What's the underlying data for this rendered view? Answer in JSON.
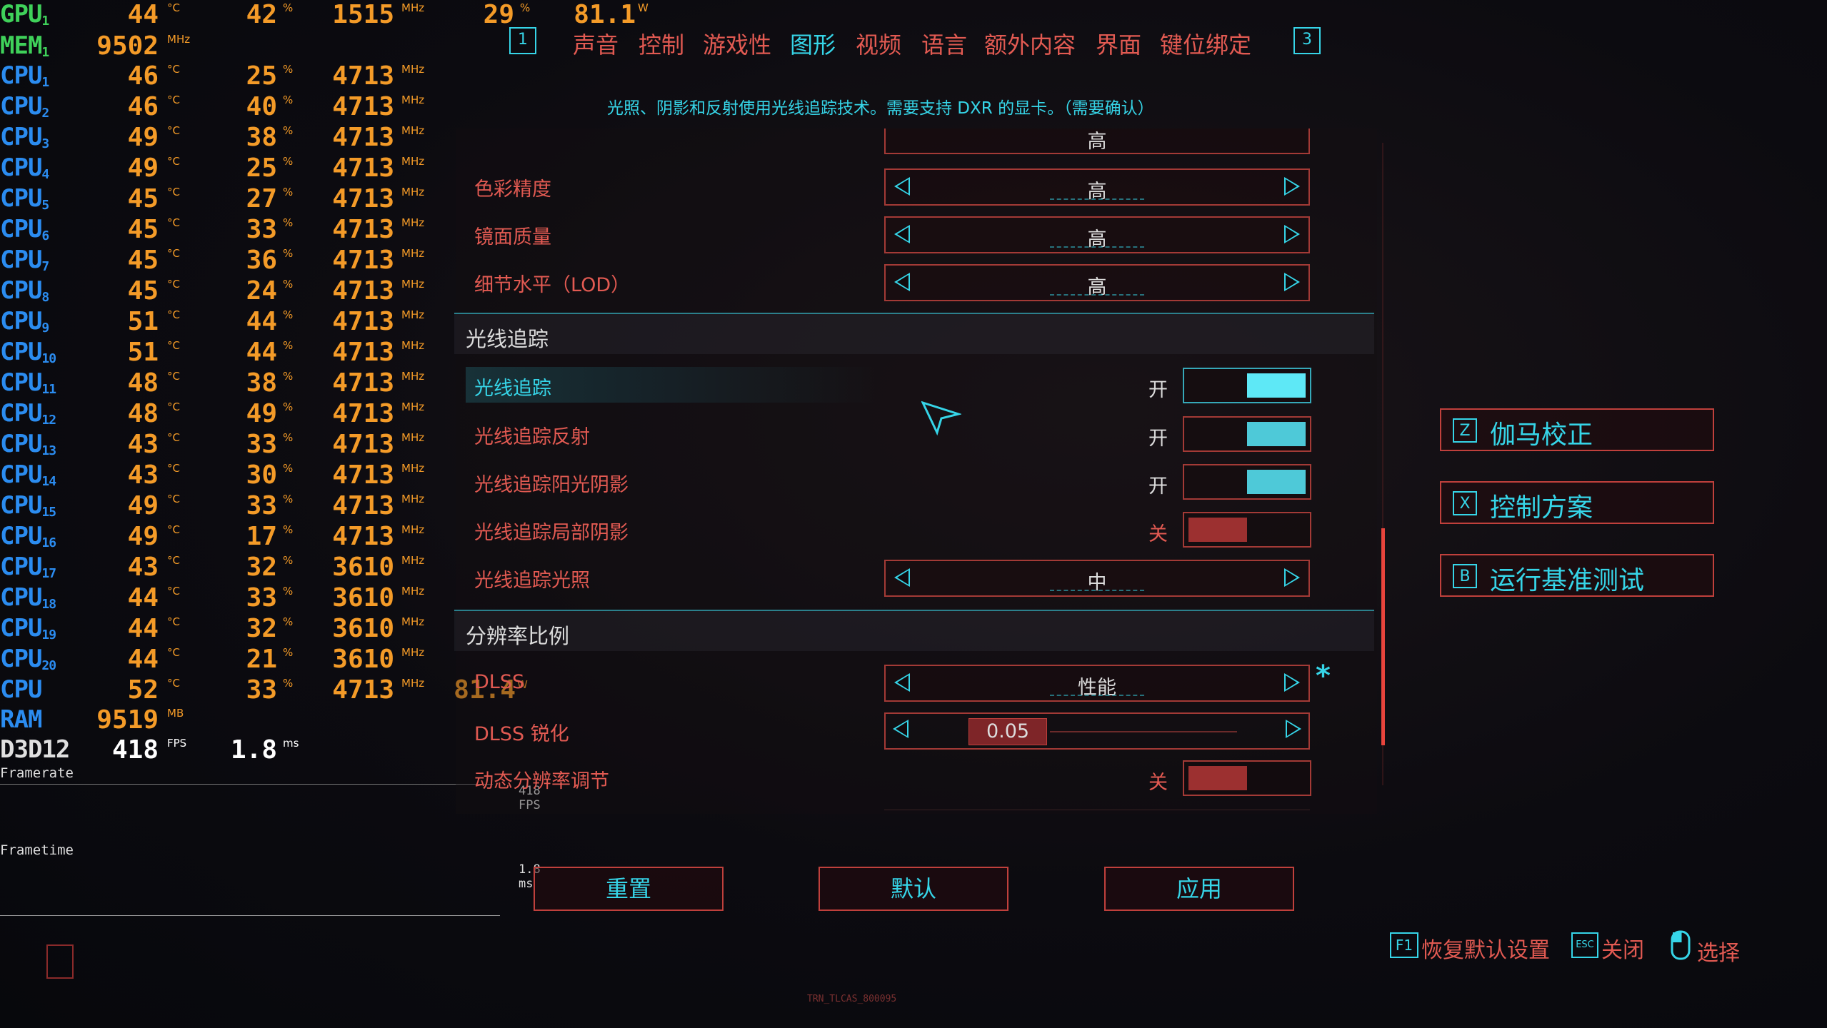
{
  "osd": {
    "gpu": {
      "label": "GPU",
      "sub": "1",
      "temp": "44",
      "temp_unit": "°C",
      "load": "42",
      "load_unit": "%",
      "clock": "1515",
      "clock_unit": "MHz",
      "mem_load": "29",
      "mem_load_unit": "%",
      "power": "81.1",
      "power_unit": "W"
    },
    "mem": {
      "label": "MEM",
      "sub": "1",
      "value": "9502",
      "unit": "MHz"
    },
    "cpus": [
      {
        "label": "CPU",
        "sub": "1",
        "temp": "46",
        "load": "25",
        "clock": "4713"
      },
      {
        "label": "CPU",
        "sub": "2",
        "temp": "46",
        "load": "40",
        "clock": "4713"
      },
      {
        "label": "CPU",
        "sub": "3",
        "temp": "49",
        "load": "38",
        "clock": "4713"
      },
      {
        "label": "CPU",
        "sub": "4",
        "temp": "49",
        "load": "25",
        "clock": "4713"
      },
      {
        "label": "CPU",
        "sub": "5",
        "temp": "45",
        "load": "27",
        "clock": "4713"
      },
      {
        "label": "CPU",
        "sub": "6",
        "temp": "45",
        "load": "33",
        "clock": "4713"
      },
      {
        "label": "CPU",
        "sub": "7",
        "temp": "45",
        "load": "36",
        "clock": "4713"
      },
      {
        "label": "CPU",
        "sub": "8",
        "temp": "45",
        "load": "24",
        "clock": "4713"
      },
      {
        "label": "CPU",
        "sub": "9",
        "temp": "51",
        "load": "44",
        "clock": "4713"
      },
      {
        "label": "CPU",
        "sub": "10",
        "temp": "51",
        "load": "44",
        "clock": "4713"
      },
      {
        "label": "CPU",
        "sub": "11",
        "temp": "48",
        "load": "38",
        "clock": "4713"
      },
      {
        "label": "CPU",
        "sub": "12",
        "temp": "48",
        "load": "49",
        "clock": "4713"
      },
      {
        "label": "CPU",
        "sub": "13",
        "temp": "43",
        "load": "33",
        "clock": "4713"
      },
      {
        "label": "CPU",
        "sub": "14",
        "temp": "43",
        "load": "30",
        "clock": "4713"
      },
      {
        "label": "CPU",
        "sub": "15",
        "temp": "49",
        "load": "33",
        "clock": "4713"
      },
      {
        "label": "CPU",
        "sub": "16",
        "temp": "49",
        "load": "17",
        "clock": "4713"
      },
      {
        "label": "CPU",
        "sub": "17",
        "temp": "43",
        "load": "32",
        "clock": "3610"
      },
      {
        "label": "CPU",
        "sub": "18",
        "temp": "44",
        "load": "33",
        "clock": "3610"
      },
      {
        "label": "CPU",
        "sub": "19",
        "temp": "44",
        "load": "32",
        "clock": "3610"
      },
      {
        "label": "CPU",
        "sub": "20",
        "temp": "44",
        "load": "21",
        "clock": "3610"
      }
    ],
    "cpu_total": {
      "label": "CPU",
      "temp": "52",
      "load": "33",
      "clock": "4713",
      "power": "81.4",
      "power_unit": "W"
    },
    "temp_unit": "°C",
    "load_unit": "%",
    "clock_unit": "MHz",
    "ram": {
      "label": "RAM",
      "value": "9519",
      "unit": "MB"
    },
    "d3d": {
      "label": "D3D12",
      "fps": "418",
      "fps_unit": "FPS",
      "frametime": "1.8",
      "frametime_unit": "ms"
    },
    "framerate_label": "Framerate",
    "framerate_value": "418 FPS",
    "frametime_label": "Frametime",
    "frametime_value": "1.8 ms"
  },
  "nav": {
    "left_key": "1",
    "right_key": "3",
    "tabs": [
      "声音",
      "控制",
      "游戏性",
      "图形",
      "视频",
      "语言",
      "额外内容",
      "界面",
      "键位绑定"
    ],
    "active_index": 3
  },
  "description": "光照、阴影和反射使用光线追踪技术。需要支持 DXR 的显卡。（需要确认）",
  "settings": {
    "partial_row": {
      "value": "高"
    },
    "rows_top": [
      {
        "label": "色彩精度",
        "value": "高"
      },
      {
        "label": "镜面质量",
        "value": "高"
      },
      {
        "label": "细节水平（LOD）",
        "value": "高"
      }
    ],
    "section_rt": "光线追踪",
    "rt_rows": [
      {
        "label": "光线追踪",
        "state": "开"
      },
      {
        "label": "光线追踪反射",
        "state": "开"
      },
      {
        "label": "光线追踪阳光阴影",
        "state": "开"
      },
      {
        "label": "光线追踪局部阴影",
        "state": "关"
      }
    ],
    "rt_lighting": {
      "label": "光线追踪光照",
      "value": "中"
    },
    "section_res": "分辨率比例",
    "dlss": {
      "label": "DLSS",
      "value": "性能",
      "asterisk": "*"
    },
    "dlss_sharp": {
      "label": "DLSS 锐化",
      "value": "0.05",
      "level": 0.05
    },
    "dynres": {
      "label": "动态分辨率调节",
      "state": "关"
    }
  },
  "buttons": {
    "reset": "重置",
    "default": "默认",
    "apply": "应用"
  },
  "quick_actions": [
    {
      "key": "Z",
      "label": "伽马校正"
    },
    {
      "key": "X",
      "label": "控制方案"
    },
    {
      "key": "B",
      "label": "运行基准测试"
    }
  ],
  "hints": {
    "restore_key": "F1",
    "restore": "恢复默认设置",
    "close_key": "ESC",
    "close": "关闭",
    "select": "选择"
  },
  "footer_code": "TRN_TLCAS_800095",
  "colors": {
    "cyan": "#36d5e8",
    "red": "#e25a52",
    "orange": "#f49b28",
    "green": "#3fd15a",
    "blue": "#2b8cf0"
  }
}
